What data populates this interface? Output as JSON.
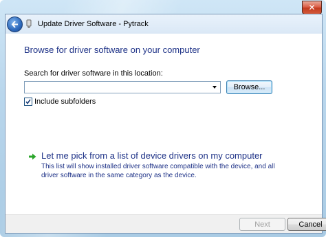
{
  "window": {
    "title": "Update Driver Software - Pytrack",
    "close_glyph": "✕"
  },
  "main": {
    "heading": "Browse for driver software on your computer",
    "search_label": "Search for driver software in this location:",
    "path_value": "",
    "browse_label": "Browse...",
    "include_subfolders_label": "Include subfolders",
    "include_subfolders_checked": true,
    "pick_link": "Let me pick from a list of device drivers on my computer",
    "pick_description": "This list will show installed driver software compatible with the device, and all driver software in the same category as the device."
  },
  "footer": {
    "next_label": "Next",
    "cancel_label": "Cancel"
  },
  "icons": {
    "back": "back-arrow-icon",
    "device": "device-icon",
    "checkbox": "check-icon",
    "pick": "green-arrow-icon"
  },
  "colors": {
    "link": "#1e3287",
    "accent_green": "#2aa52a"
  }
}
